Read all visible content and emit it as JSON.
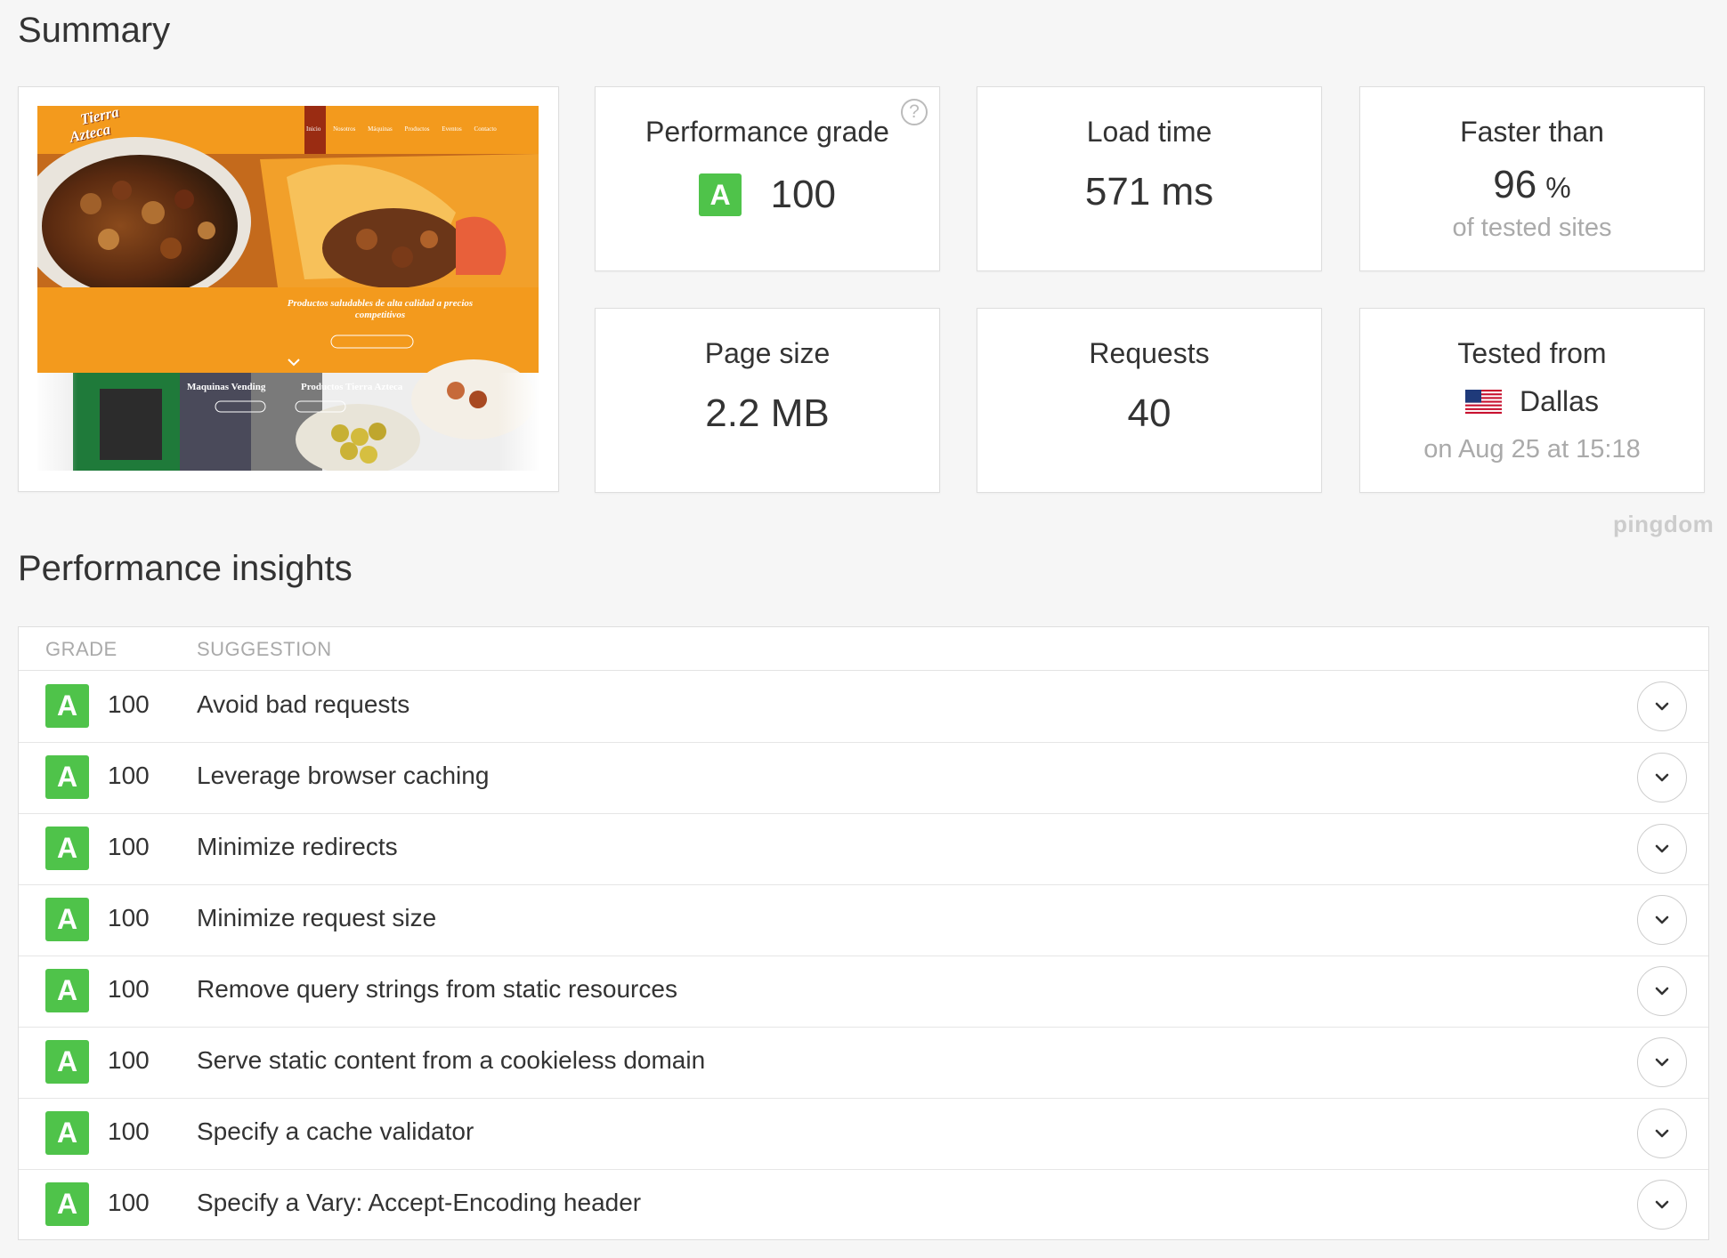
{
  "summary": {
    "title": "Summary"
  },
  "screenshot": {
    "logo_line1": "Tierra",
    "logo_line2": "Azteca",
    "nav": [
      "Inicio",
      "Nosotros",
      "Máquinas",
      "Productos",
      "Eventos",
      "Contacto"
    ],
    "tagline_line1": "Productos saludables de alta calidad a precios",
    "tagline_line2": "competitivos",
    "tile1": "Maquinas Vending",
    "tile2": "Productos Tierra Azteca"
  },
  "metrics": {
    "grade": {
      "label": "Performance grade",
      "letter": "A",
      "value": "100",
      "help": "?"
    },
    "load_time": {
      "label": "Load time",
      "value": "571 ms"
    },
    "faster": {
      "label": "Faster than",
      "value": "96",
      "unit": "%",
      "sub": "of tested sites"
    },
    "page_size": {
      "label": "Page size",
      "value": "2.2 MB"
    },
    "requests": {
      "label": "Requests",
      "value": "40"
    },
    "tested": {
      "label": "Tested from",
      "location": "Dallas",
      "sub": "on Aug 25 at 15:18",
      "flag": "us-flag-icon"
    }
  },
  "brand": "pingdom",
  "insights": {
    "title": "Performance insights",
    "columns": {
      "grade": "GRADE",
      "suggestion": "SUGGESTION"
    },
    "rows": [
      {
        "letter": "A",
        "score": "100",
        "suggestion": "Avoid bad requests"
      },
      {
        "letter": "A",
        "score": "100",
        "suggestion": "Leverage browser caching"
      },
      {
        "letter": "A",
        "score": "100",
        "suggestion": "Minimize redirects"
      },
      {
        "letter": "A",
        "score": "100",
        "suggestion": "Minimize request size"
      },
      {
        "letter": "A",
        "score": "100",
        "suggestion": "Remove query strings from static resources"
      },
      {
        "letter": "A",
        "score": "100",
        "suggestion": "Serve static content from a cookieless domain"
      },
      {
        "letter": "A",
        "score": "100",
        "suggestion": "Specify a cache validator"
      },
      {
        "letter": "A",
        "score": "100",
        "suggestion": "Specify a Vary: Accept-Encoding header"
      }
    ]
  },
  "colors": {
    "grade_green": "#4fc34a",
    "accent_orange": "#f39a1d"
  }
}
